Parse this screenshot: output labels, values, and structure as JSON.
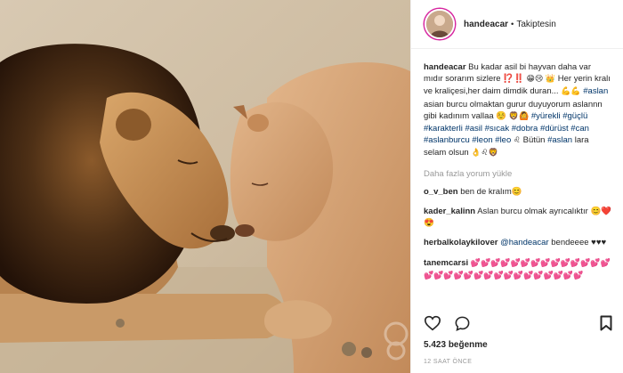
{
  "post": {
    "username": "handeacar",
    "separator": "•",
    "follow_status": "Takiptesin",
    "caption_user": "handeacar",
    "caption_text_1": "Bu kadar asil bi hayvan daha var mıdır sorarım sizlere ⁉️‼️",
    "caption_text_2": "Her yerin kralı ve kraliçesi,her daim dimdik duran...",
    "caption_text_3": "asian burcu olmaktan gurur duyuyorum aslannn gibi kadınım vallaa ☺️",
    "hashtags_1": "#yürekli #güçlü #karakterli #asil #sıcak #dobra #dürüst #can #aslanburcu #leon #leo",
    "caption_text_4": "Bütün",
    "hashtag_aslan": "#aslan",
    "caption_text_5": "lara selam olsun",
    "load_more": "Daha fazla yorum yükle",
    "comments": [
      {
        "user": "o_v_ben",
        "text": "ben de kralım😊"
      },
      {
        "user": "kader_kalinn",
        "text": "Aslan burcu olmak ayrıcalıktır 😊❤️😍"
      },
      {
        "user": "herbalkolaykilover",
        "mention": "@handeacar",
        "text": "bendeeee ♥♥♥"
      },
      {
        "user": "tanemcarsi",
        "text": "💕💕💕💕💕💕💕💕💕💕💕💕💕💕💕💕💕💕💕💕💕💕💕💕💕💕💕💕💕💕"
      }
    ],
    "likes_count": "5.423",
    "likes_label": "beğenme",
    "time_ago": "12 SAAT ÖNCE"
  },
  "icons": [
    "heart-icon",
    "comment-icon",
    "bookmark-icon"
  ],
  "colors": {
    "hashtag": "#003569",
    "muted": "#999999",
    "avatar_ring": "#d6249f"
  }
}
